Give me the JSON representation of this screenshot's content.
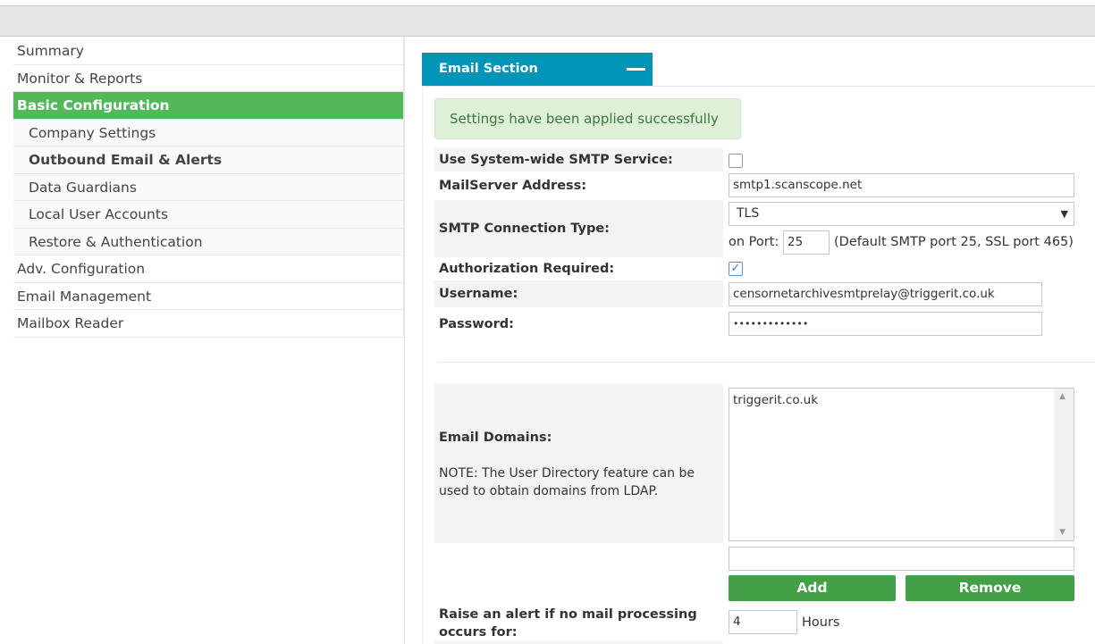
{
  "sidebar": {
    "items": [
      {
        "label": "Summary"
      },
      {
        "label": "Monitor & Reports"
      },
      {
        "label": "Basic Configuration"
      },
      {
        "label": "Company Settings"
      },
      {
        "label": "Outbound Email & Alerts"
      },
      {
        "label": "Data Guardians"
      },
      {
        "label": "Local User Accounts"
      },
      {
        "label": "Restore & Authentication"
      },
      {
        "label": "Adv. Configuration"
      },
      {
        "label": "Email Management"
      },
      {
        "label": "Mailbox Reader"
      }
    ]
  },
  "section": {
    "title": "Email Section",
    "collapse_icon": "minus-icon"
  },
  "alert": {
    "message": "Settings have been applied successfully"
  },
  "form": {
    "system_smtp": {
      "label": "Use System-wide SMTP Service:",
      "checked": false
    },
    "mailserver": {
      "label": "MailServer Address:",
      "value": "smtp1.scanscope.net"
    },
    "connection": {
      "label": "SMTP Connection Type:",
      "value": "TLS",
      "port_label": "on Port:",
      "port": "25",
      "port_hint": "(Default SMTP port 25, SSL port 465)"
    },
    "auth": {
      "label": "Authorization Required:",
      "checked": true
    },
    "username": {
      "label": "Username:",
      "value": "censornetarchivesmtprelay@triggerit.co.uk"
    },
    "password": {
      "label": "Password:",
      "value": "•••••••••••••"
    },
    "domains": {
      "label": "Email Domains:",
      "note": "NOTE: The User Directory feature can be used to obtain domains from LDAP.",
      "items": [
        "triggerit.co.uk"
      ],
      "new_value": "",
      "add_label": "Add",
      "remove_label": "Remove"
    },
    "alert_hours": {
      "label": "Raise an alert if no mail processing occurs for:",
      "value": "4",
      "unit": "Hours"
    }
  },
  "colors": {
    "accent": "#0095b6",
    "active_nav": "#52b85a",
    "button": "#43a047",
    "alert_bg": "#dff0d8"
  }
}
